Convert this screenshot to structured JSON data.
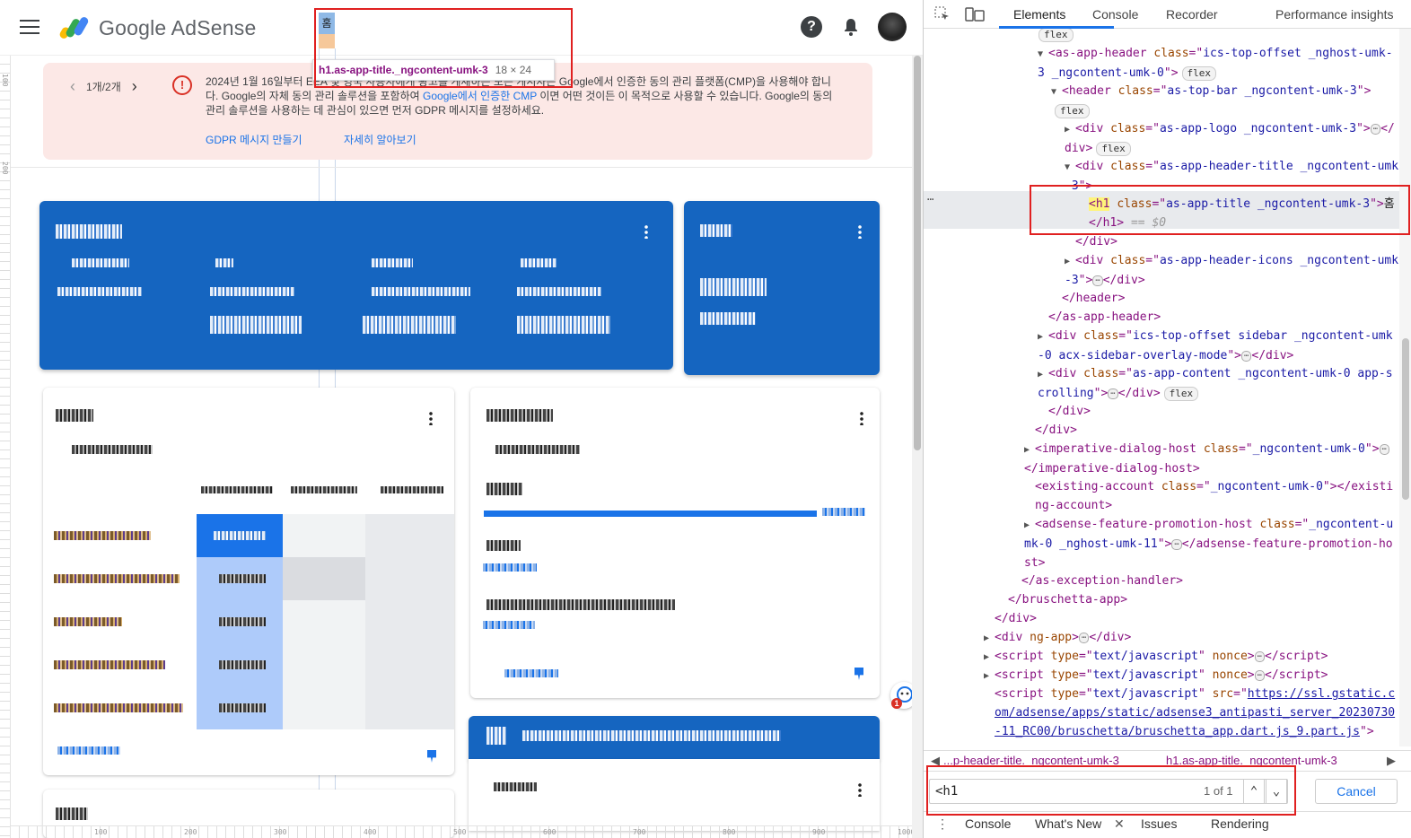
{
  "adsense": {
    "brand": "Google AdSense",
    "page_title": "홈",
    "tooltip": {
      "selector": "h1.as-app-title._ngcontent-umk-3",
      "size": "18 × 24"
    },
    "banner": {
      "pager": "1개/2개",
      "text_a": "2024년 1월 16일부터 EEA 및 영국 사용자에게 광고를 게재하는 모든 게시자는 Google에서 인증한 동의 관리 플랫폼(CMP)을 사용해야 합니다. Google의 자체 동의 관리 솔루션을 포함하여 ",
      "text_link": "Google에서 인증한 CMP",
      "text_b": " 이면 어떤 것이든 이 목적으로 사용할 수 있습니다. Google의 동의 관리 솔루션을 사용하는 데 관심이 있으면 먼저 GDPR 메시지를 설정하세요.",
      "link1": "GDPR 메시지 만들기",
      "link2": "자세히 알아보기"
    },
    "ruler_marks": [
      "100",
      "200",
      "300",
      "400",
      "500",
      "600",
      "700",
      "800",
      "900",
      "1000"
    ],
    "ruler_v_marks": [
      "100",
      "200"
    ],
    "fab_badge": "1"
  },
  "devtools": {
    "tabs": [
      "Elements",
      "Console",
      "Recorder",
      "Performance insights"
    ],
    "active_tab": "Elements",
    "tree": [
      {
        "indent": 0,
        "raw": "flex"
      },
      {
        "indent": 1,
        "tri": "▼",
        "tag": "as-app-header",
        "attrs": [
          [
            "class",
            "ics-top-offset _nghost-umk-3 _ngcontent-umk-0"
          ]
        ],
        "badge": "flex"
      },
      {
        "indent": 2,
        "tri": "▼",
        "tag": "header",
        "attrs": [
          [
            "class",
            "as-top-bar _ngcontent-umk-3"
          ]
        ],
        "badge": "flex"
      },
      {
        "indent": 3,
        "tri": "▶",
        "tag": "div",
        "attrs": [
          [
            "class",
            "as-app-logo _ngcontent-umk-3"
          ]
        ],
        "collapsed": true,
        "badge": "flex"
      },
      {
        "indent": 3,
        "tri": "▼",
        "tag": "div",
        "attrs": [
          [
            "class",
            "as-app-header-title _ngcontent-umk-3"
          ]
        ]
      },
      {
        "indent": 4,
        "selected": true,
        "tag": "h1",
        "attrs": [
          [
            "class",
            "as-app-title _ngcontent-umk-3"
          ]
        ],
        "text": "홈",
        "suffix": "== $0"
      },
      {
        "indent": 3,
        "close": "div"
      },
      {
        "indent": 3,
        "tri": "▶",
        "tag": "div",
        "attrs": [
          [
            "class",
            "as-app-header-icons _ngcontent-umk-3"
          ]
        ],
        "collapsed": true
      },
      {
        "indent": 2,
        "close": "header"
      },
      {
        "indent": 1,
        "close": "as-app-header"
      },
      {
        "indent": 1,
        "tri": "▶",
        "tag": "div",
        "attrs": [
          [
            "class",
            "ics-top-offset sidebar _ngcontent-umk-0 acx-sidebar-overlay-mode"
          ]
        ],
        "collapsed": true
      },
      {
        "indent": 1,
        "tri": "▶",
        "tag": "div",
        "attrs": [
          [
            "class",
            "as-app-content _ngcontent-umk-0 app-scrolling"
          ]
        ],
        "collapsed": true,
        "badge": "flex"
      },
      {
        "indent": 1,
        "close": "div"
      },
      {
        "indent": 0,
        "close": "div"
      },
      {
        "indent": 0,
        "tri": "▶",
        "tag": "imperative-dialog-host",
        "attrs": [
          [
            "class",
            "_ngcontent-umk-0"
          ]
        ],
        "collapsed": true
      },
      {
        "indent": 0,
        "tag": "existing-account",
        "attrs": [
          [
            "class",
            "_ngcontent-umk-0"
          ]
        ],
        "emptyclose": true
      },
      {
        "indent": 0,
        "tri": "▶",
        "tag": "adsense-feature-promotion-host",
        "attrs": [
          [
            "class",
            "_ngcontent-umk-0 _nghost-umk-11"
          ]
        ],
        "collapsed": true
      },
      {
        "indent": -1,
        "close": "as-exception-handler"
      },
      {
        "indent": -2,
        "close": "bruschetta-app"
      },
      {
        "indent": -3,
        "close": "div"
      },
      {
        "indent": -3,
        "tri": "▶",
        "tag": "div",
        "attrs": [
          [
            "ng-app",
            ""
          ]
        ],
        "collapsed": true
      },
      {
        "indent": -3,
        "tri": "▶",
        "tag": "script",
        "attrs": [
          [
            "type",
            "text/javascript"
          ],
          [
            "nonce",
            ""
          ]
        ],
        "collapsed": true
      },
      {
        "indent": -3,
        "tri": "▶",
        "tag": "script",
        "attrs": [
          [
            "type",
            "text/javascript"
          ],
          [
            "nonce",
            ""
          ]
        ],
        "collapsed": true
      },
      {
        "indent": -3,
        "tag": "script",
        "attrs": [
          [
            "type",
            "text/javascript"
          ],
          [
            "src",
            "https://ssl.gstatic.com/adsense/apps/static/adsense3_antipasti_server_20230730-11_RC00/bruschetta/bruschetta_app.dart.js_9.part.js"
          ]
        ],
        "url": true
      }
    ],
    "breadcrumbs": [
      "...p-header-title._ngcontent-umk-3",
      "h1.as-app-title._ngcontent-umk-3"
    ],
    "search": {
      "value": "<h1",
      "count": "1 of 1",
      "cancel": "Cancel"
    },
    "drawer": [
      "Console",
      "What's New",
      "Issues",
      "Rendering"
    ]
  }
}
